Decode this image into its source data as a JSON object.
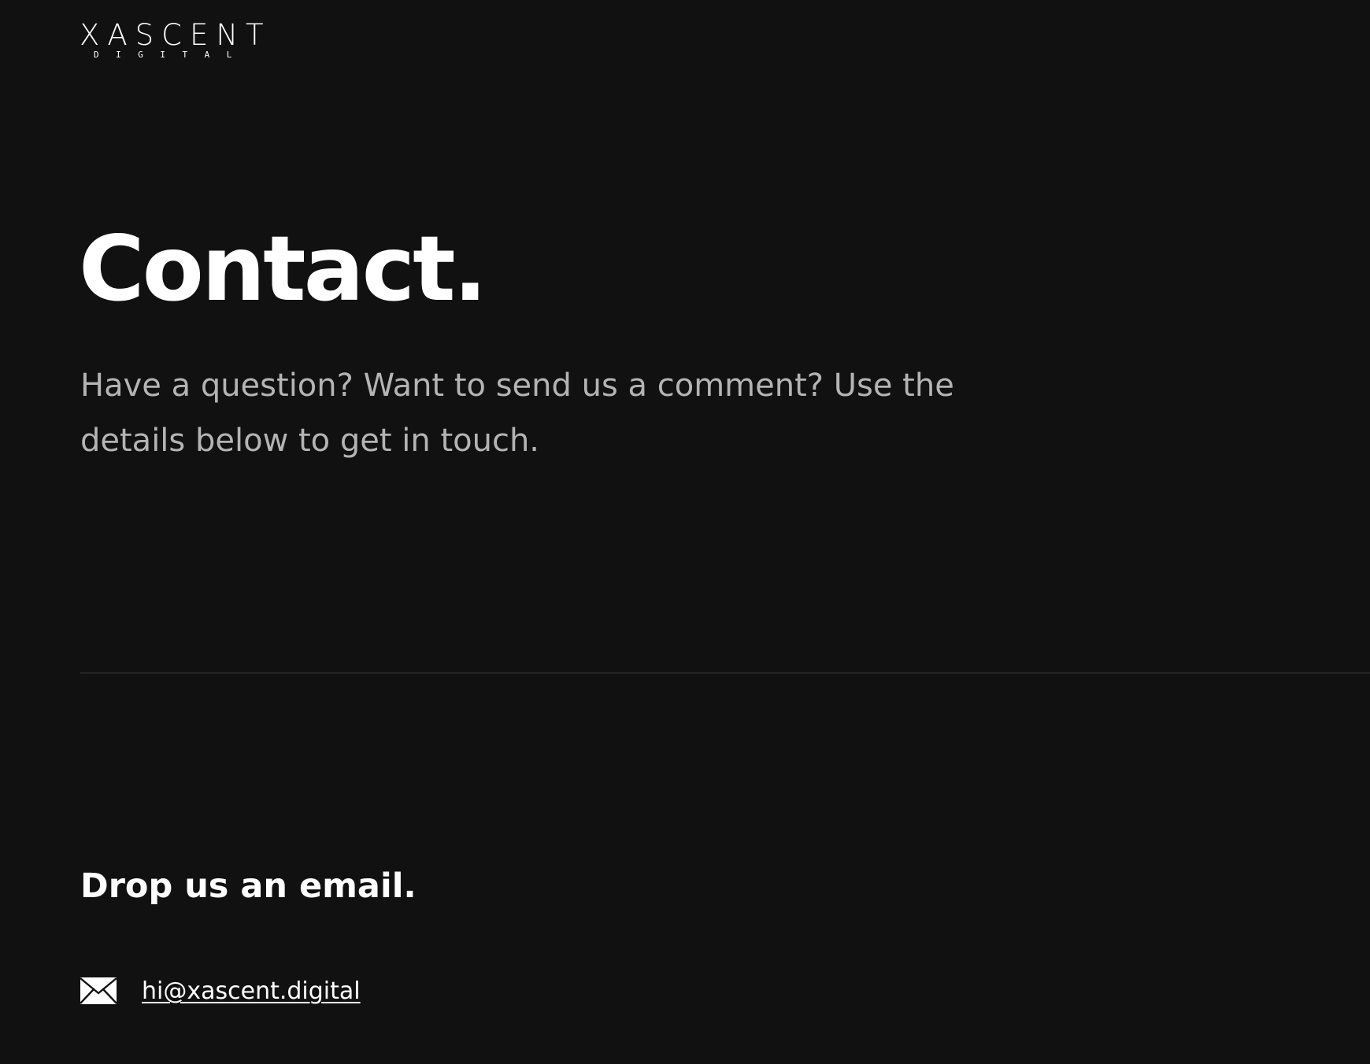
{
  "logo": {
    "wordmark": "XASCENT",
    "sub": "DIGITAL"
  },
  "hero": {
    "title": "Contact.",
    "intro": "Have a question? Want to send us a comment? Use the details below to get in touch."
  },
  "email_section": {
    "heading": "Drop us an email.",
    "icon": "envelope-icon",
    "address": "hi@xascent.digital"
  },
  "colors": {
    "background": "#111111",
    "text": "#ffffff",
    "muted_text": "#b4b4b4",
    "divider": "#242424"
  }
}
